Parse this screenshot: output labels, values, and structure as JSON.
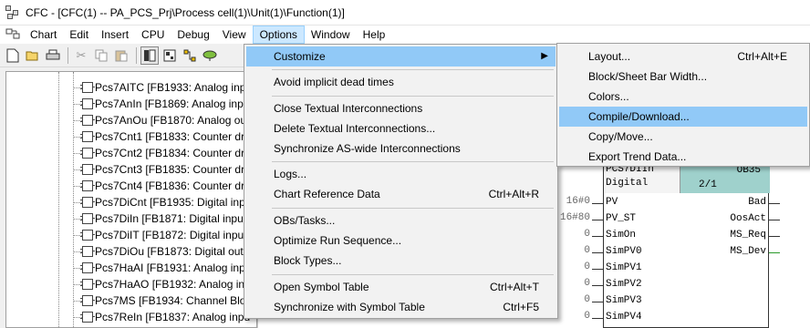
{
  "window": {
    "title": "CFC - [CFC(1) -- PA_PCS_Prj\\Process cell(1)\\Unit(1)\\Function(1)]"
  },
  "menubar": {
    "items": [
      "Chart",
      "Edit",
      "Insert",
      "CPU",
      "Debug",
      "View",
      "Options",
      "Window",
      "Help"
    ],
    "active": "Options"
  },
  "toolbar": {
    "buttons": [
      "new-icon",
      "open-icon",
      "print-icon",
      "cut-icon",
      "copy-icon",
      "paste-icon",
      "catalog-icon",
      "overview-icon",
      "interconnect-icon",
      "test-icon"
    ]
  },
  "tree": {
    "items": [
      "Pcs7AITC  [FB1933: Analog inp",
      "Pcs7AnIn  [FB1869: Analog inp",
      "Pcs7AnOu  [FB1870: Analog ou",
      "Pcs7Cnt1  [FB1833: Counter dr",
      "Pcs7Cnt2  [FB1834: Counter dr",
      "Pcs7Cnt3  [FB1835: Counter dr",
      "Pcs7Cnt4  [FB1836: Counter dr",
      "Pcs7DiCnt  [FB1935: Digital inp",
      "Pcs7DiIn  [FB1871: Digital inpu",
      "Pcs7DiIT  [FB1872: Digital inpu",
      "Pcs7DiOu  [FB1873: Digital out",
      "Pcs7HaAI  [FB1931: Analog inp",
      "Pcs7HaAO  [FB1932: Analog inp",
      "Pcs7MS  [FB1934: Channel Bloc",
      "Pcs7ReIn  [FB1837: Analog inpu"
    ]
  },
  "block": {
    "name_line1": "PCS7DIIn",
    "name_line2": "Digital",
    "ob": "OB35",
    "seq": "2/1",
    "inputs": [
      "PV",
      "PV_ST",
      "SimOn",
      "SimPV0",
      "SimPV1",
      "SimPV2",
      "SimPV3",
      "SimPV4"
    ],
    "input_values": [
      "16#0",
      "16#80",
      "0",
      "0",
      "0",
      "0",
      "0",
      "0"
    ],
    "outputs": [
      "Bad",
      "OosAct",
      "MS_Req",
      "MS_Dev"
    ]
  },
  "options_menu": {
    "items": [
      {
        "label": "Customize",
        "accel": "",
        "submenu": true
      },
      {
        "label": "Avoid implicit dead times",
        "accel": ""
      },
      {
        "label": "Close Textual Interconnections",
        "accel": ""
      },
      {
        "label": "Delete Textual Interconnections...",
        "accel": ""
      },
      {
        "label": "Synchronize AS-wide Interconnections",
        "accel": ""
      },
      {
        "label": "Logs...",
        "accel": ""
      },
      {
        "label": "Chart Reference Data",
        "accel": "Ctrl+Alt+R"
      },
      {
        "label": "OBs/Tasks...",
        "accel": ""
      },
      {
        "label": "Optimize Run Sequence...",
        "accel": ""
      },
      {
        "label": "Block Types...",
        "accel": ""
      },
      {
        "label": "Open Symbol Table",
        "accel": "Ctrl+Alt+T"
      },
      {
        "label": "Synchronize with Symbol Table",
        "accel": "Ctrl+F5"
      }
    ]
  },
  "customize_submenu": {
    "items": [
      {
        "label": "Layout...",
        "accel": "Ctrl+Alt+E"
      },
      {
        "label": "Block/Sheet Bar Width...",
        "accel": ""
      },
      {
        "label": "Colors...",
        "accel": ""
      },
      {
        "label": "Compile/Download...",
        "accel": ""
      },
      {
        "label": "Copy/Move...",
        "accel": ""
      },
      {
        "label": "Export Trend Data...",
        "accel": ""
      }
    ]
  },
  "colors": {
    "highlight": "#91c9f7",
    "block_header": "#9fd1cc",
    "menu_active": "#cce8ff"
  }
}
